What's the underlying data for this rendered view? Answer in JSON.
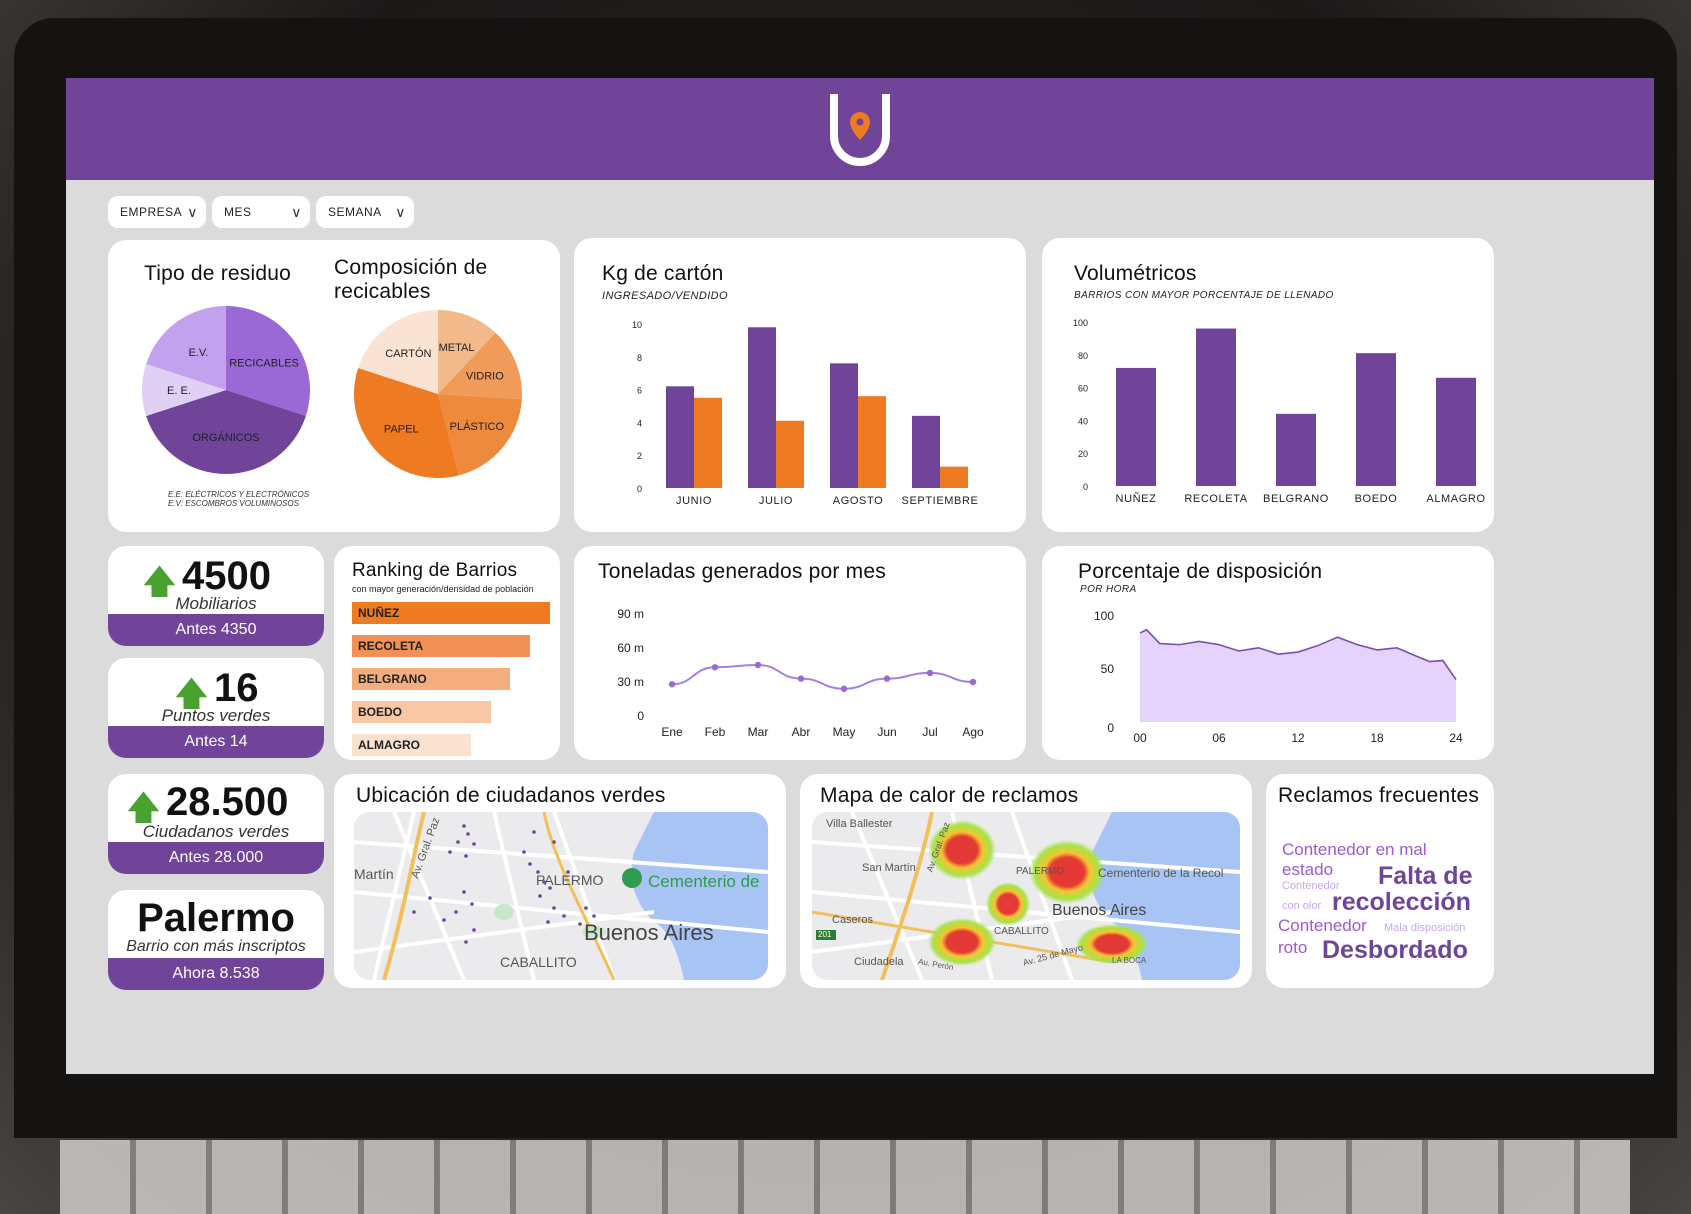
{
  "filters": [
    {
      "label": "EMPRESA"
    },
    {
      "label": "MES"
    },
    {
      "label": "SEMANA"
    }
  ],
  "waste": {
    "title_tipo": "Tipo de residuo",
    "title_comp": "Composición de recicables",
    "tipo_slices": [
      {
        "label": "RECICABLES",
        "color": "#9b69d6"
      },
      {
        "label": "ORGÁNICOS",
        "color": "#6f4499"
      },
      {
        "label": "E. E.",
        "color": "#e1d0f6"
      },
      {
        "label": "E.V.",
        "color": "#c2a2ee"
      }
    ],
    "comp_slices": [
      {
        "label": "METAL",
        "color": "#f2b98b"
      },
      {
        "label": "VIDRIO",
        "color": "#f19b5b"
      },
      {
        "label": "PLÁSTICO",
        "color": "#ee8a3c"
      },
      {
        "label": "PAPEL",
        "color": "#ee7a22"
      },
      {
        "label": "CARTÓN",
        "color": "#fae3d2"
      }
    ],
    "note_1": "E.E: ELÉCTRICOS Y ELECTRÓNICOS",
    "note_2": "E.V: ESCOMBROS VOLUMINOSOS"
  },
  "carton": {
    "title": "Kg de cartón",
    "subtitle": "INGRESADO/VENDIDO"
  },
  "volumetricos": {
    "title": "Volumétricos",
    "subtitle": "BARRIOS CON MAYOR PORCENTAJE DE LLENADO"
  },
  "kpis": [
    {
      "value": "4500",
      "label": "Mobiliarios",
      "foot": "Antes 4350"
    },
    {
      "value": "16",
      "label": "Puntos verdes",
      "foot": "Antes 14"
    },
    {
      "value": "28.500",
      "label": "Ciudadanos verdes",
      "foot": "Antes 28.000"
    },
    {
      "value": "Palermo",
      "label": "Barrio con más inscriptos",
      "foot": "Ahora 8.538"
    }
  ],
  "ranking": {
    "title": "Ranking de Barrios",
    "subtitle": "con mayor generación/densidad de población",
    "items": [
      {
        "label": "NUÑEZ",
        "value": 1.0,
        "color": "#ee7a22"
      },
      {
        "label": "RECOLETA",
        "value": 0.9,
        "color": "#f19155"
      },
      {
        "label": "BELGRANO",
        "value": 0.8,
        "color": "#f4ad7e"
      },
      {
        "label": "BOEDO",
        "value": 0.7,
        "color": "#f7c7a6"
      },
      {
        "label": "ALMAGRO",
        "value": 0.6,
        "color": "#fae2d1"
      }
    ]
  },
  "toneladas": {
    "title": "Toneladas generados por mes"
  },
  "disposicion": {
    "title": "Porcentaje de disposición",
    "subtitle": "POR HORA"
  },
  "ubicacion": {
    "title": "Ubicación de ciudadanos verdes",
    "labels": {
      "palermo": "PALERMO",
      "cementerio": "Cementerio de",
      "ba": "Buenos Aires",
      "caballito": "CABALLITO",
      "martin": "Martín",
      "av": "Av. Gral. Paz"
    }
  },
  "calor": {
    "title": "Mapa de calor de reclamos",
    "labels": {
      "villa": "Villa Ballester",
      "sanmartin": "San Martín",
      "palermo": "PALERMO",
      "cementerio": "Cementerio de la Recol",
      "ba": "Buenos Aires",
      "caseros": "Caseros",
      "caballito": "CABALLITO",
      "ciudadela": "Ciudadela",
      "mayo": "Av. 25 de Mayo",
      "laboca": "LA BOCA",
      "av": "Av. Gral. Paz",
      "ruta": "201",
      "peron": "Au. Perón"
    }
  },
  "reclamos": {
    "title": "Reclamos frecuentes",
    "words": [
      "Contenedor en mal",
      "estado",
      "Falta de",
      "Contenedor",
      "con olor",
      "recolección",
      "Contenedor",
      "Mala disposición",
      "roto",
      "Desbordado"
    ]
  },
  "chart_data": [
    {
      "type": "pie",
      "title": "Tipo de residuo",
      "categories": [
        "RECICABLES",
        "ORGÁNICOS",
        "E. E.",
        "E.V."
      ],
      "values": [
        30,
        40,
        10,
        20
      ]
    },
    {
      "type": "pie",
      "title": "Composición de recicables",
      "categories": [
        "METAL",
        "VIDRIO",
        "PLÁSTICO",
        "PAPEL",
        "CARTÓN"
      ],
      "values": [
        12,
        14,
        20,
        34,
        20
      ]
    },
    {
      "type": "bar",
      "title": "Kg de cartón",
      "subtitle": "INGRESADO/VENDIDO",
      "categories": [
        "JUNIO",
        "JULIO",
        "AGOSTO",
        "SEPTIEMBRE"
      ],
      "series": [
        {
          "values": [
            6.2,
            9.8,
            7.6,
            4.4
          ],
          "color": "#6f4499"
        },
        {
          "values": [
            5.5,
            4.1,
            5.6,
            1.3
          ],
          "color": "#ee7a22"
        }
      ],
      "yticks": [
        0,
        2,
        4,
        6,
        8,
        10
      ],
      "ylim": [
        0,
        10
      ]
    },
    {
      "type": "bar",
      "title": "Volumétricos",
      "subtitle": "BARRIOS CON MAYOR PORCENTAJE DE LLENADO",
      "categories": [
        "NUÑEZ",
        "RECOLETA",
        "BELGRANO",
        "BOEDO",
        "ALMAGRO"
      ],
      "values": [
        72,
        96,
        44,
        81,
        66
      ],
      "yticks": [
        0,
        20,
        40,
        60,
        80,
        100
      ],
      "ylim": [
        0,
        100
      ],
      "color": "#6f4499"
    },
    {
      "type": "line",
      "title": "Toneladas generados por mes",
      "categories": [
        "Ene",
        "Feb",
        "Mar",
        "Abr",
        "May",
        "Jun",
        "Jul",
        "Ago"
      ],
      "values": [
        28,
        43,
        45,
        33,
        24,
        33,
        38,
        30
      ],
      "yticks": [
        "0",
        "30 m",
        "60 m",
        "90 m"
      ],
      "ylim": [
        0,
        90
      ]
    },
    {
      "type": "area",
      "title": "Porcentaje de disposición",
      "subtitle": "POR HORA",
      "xticks": [
        "00",
        "06",
        "12",
        "18",
        "24"
      ],
      "yticks": [
        "0",
        "50",
        "100"
      ],
      "ylim": [
        0,
        100
      ],
      "x": [
        0,
        0.5,
        1.5,
        3,
        4.5,
        6,
        7.5,
        9,
        10.5,
        12,
        13.5,
        15,
        16.5,
        18,
        19.5,
        21,
        22,
        23,
        24
      ],
      "values": [
        84,
        87,
        74,
        73,
        76,
        73,
        67,
        70,
        64,
        66,
        72,
        80,
        73,
        68,
        70,
        62,
        57,
        58,
        40
      ]
    }
  ]
}
